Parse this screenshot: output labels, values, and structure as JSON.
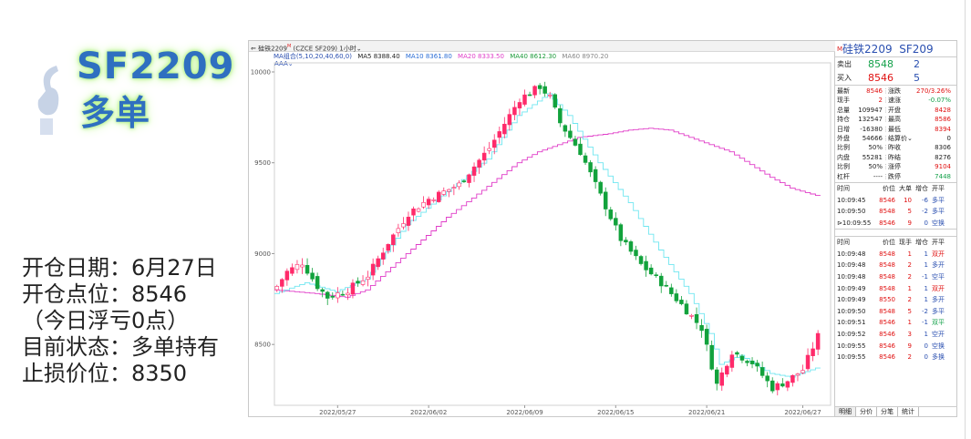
{
  "left": {
    "title": "SF2209",
    "subtitle": "多单",
    "lines": [
      "开仓日期：6月27日",
      "开仓点位：8546",
      "（今日浮亏0点）",
      "目前状态：多单持有",
      "止损价位：8350"
    ]
  },
  "chart_header": {
    "symbol_tab": "硅铁2209",
    "symbol_code": "(CZCE SF209)",
    "period": "1小时",
    "ma_group": "MA组合(5,10,20,40,60,0)",
    "ma5": "MA5 8388.40",
    "ma10": "MA10 8361.80",
    "ma20": "MA20 8333.50",
    "ma40": "MA40 8612.30",
    "ma60": "MA60 8970.20",
    "aaa": "AAA"
  },
  "colors": {
    "up": "#ff2a6a",
    "down": "#12a23c",
    "ma_cyan": "#6fe6f0",
    "ma_magenta": "#e03cc8",
    "ma10": "#2a6dd6",
    "ma20": "#e03cc8",
    "ma40": "#1c9b3a",
    "ma60": "#888888"
  },
  "chart_data": {
    "type": "candlestick",
    "title": "",
    "ylim": [
      8165,
      10050
    ],
    "y_ticks": [
      "10000",
      "9500",
      "9000",
      "8500"
    ],
    "y_tick_values": [
      10000,
      9500,
      9000,
      8500
    ],
    "x_tick_labels": [
      "2022/05/27",
      "2022/06/02",
      "2022/06/09",
      "2022/06/15",
      "2022/06/21",
      "2022/06/27"
    ],
    "x_tick_index": [
      12,
      30,
      49,
      67,
      85,
      104
    ],
    "x_count": 110,
    "anchors_close": [
      [
        0,
        8820
      ],
      [
        2,
        8900
      ],
      [
        5,
        8950
      ],
      [
        8,
        8820
      ],
      [
        10,
        8760
      ],
      [
        14,
        8800
      ],
      [
        18,
        8880
      ],
      [
        22,
        9060
      ],
      [
        26,
        9220
      ],
      [
        30,
        9300
      ],
      [
        36,
        9380
      ],
      [
        42,
        9580
      ],
      [
        48,
        9850
      ],
      [
        52,
        9920
      ],
      [
        54,
        9860
      ],
      [
        56,
        9720
      ],
      [
        60,
        9560
      ],
      [
        64,
        9320
      ],
      [
        68,
        9080
      ],
      [
        72,
        8940
      ],
      [
        76,
        8840
      ],
      [
        80,
        8720
      ],
      [
        84,
        8590
      ],
      [
        87,
        8280
      ],
      [
        90,
        8460
      ],
      [
        94,
        8400
      ],
      [
        98,
        8260
      ],
      [
        101,
        8300
      ],
      [
        104,
        8360
      ],
      [
        107,
        8546
      ]
    ],
    "ma_cyan_anchors": [
      [
        0,
        8780
      ],
      [
        6,
        8840
      ],
      [
        12,
        8790
      ],
      [
        18,
        8860
      ],
      [
        26,
        9160
      ],
      [
        34,
        9340
      ],
      [
        42,
        9520
      ],
      [
        48,
        9760
      ],
      [
        54,
        9880
      ],
      [
        58,
        9760
      ],
      [
        64,
        9500
      ],
      [
        70,
        9280
      ],
      [
        76,
        9020
      ],
      [
        82,
        8780
      ],
      [
        86,
        8560
      ],
      [
        88,
        8390
      ],
      [
        92,
        8440
      ],
      [
        98,
        8340
      ],
      [
        102,
        8320
      ],
      [
        107,
        8370
      ]
    ],
    "ma_magenta_anchors": [
      [
        0,
        8800
      ],
      [
        8,
        8780
      ],
      [
        14,
        8760
      ],
      [
        18,
        8800
      ],
      [
        26,
        9000
      ],
      [
        34,
        9200
      ],
      [
        42,
        9370
      ],
      [
        48,
        9500
      ],
      [
        52,
        9560
      ],
      [
        60,
        9640
      ],
      [
        66,
        9660
      ],
      [
        70,
        9680
      ],
      [
        74,
        9690
      ],
      [
        78,
        9680
      ],
      [
        82,
        9640
      ],
      [
        86,
        9600
      ],
      [
        90,
        9560
      ],
      [
        94,
        9490
      ],
      [
        98,
        9420
      ],
      [
        102,
        9360
      ],
      [
        107,
        9320
      ]
    ]
  },
  "quote": {
    "title_mark": "M",
    "title": "硅铁2209",
    "code": "SF209",
    "sell_label": "卖出",
    "sell_price": "8548",
    "sell_vol": "2",
    "buy_label": "买入",
    "buy_price": "8546",
    "buy_vol": "5",
    "stats": [
      {
        "a": "最新",
        "b": "8546",
        "bc": "red",
        "c": "涨跌",
        "d": "270/3.26%",
        "dc": "red"
      },
      {
        "a": "现手",
        "b": "2",
        "bc": "red",
        "c": "速涨",
        "d": "-0.07%",
        "dc": "green"
      },
      {
        "a": "总量",
        "b": "109947",
        "bc": "",
        "c": "开盘",
        "d": "8428",
        "dc": "red"
      },
      {
        "a": "持仓",
        "b": "132547",
        "bc": "",
        "c": "最高",
        "d": "8586",
        "dc": "red"
      },
      {
        "a": "日增",
        "b": "-16380",
        "bc": "",
        "c": "最低",
        "d": "8394",
        "dc": "red"
      },
      {
        "a": "外盘",
        "b": "54666",
        "bc": "",
        "c": "结算价⌄",
        "d": "0",
        "dc": ""
      },
      {
        "a": "比例",
        "b": "50%",
        "bc": "",
        "c": "昨收",
        "d": "8306",
        "dc": ""
      },
      {
        "a": "内盘",
        "b": "55281",
        "bc": "",
        "c": "昨结",
        "d": "8276",
        "dc": ""
      },
      {
        "a": "比例",
        "b": "50%",
        "bc": "",
        "c": "涨停",
        "d": "9104",
        "dc": "red"
      },
      {
        "a": "杠杆",
        "b": "----",
        "bc": "",
        "c": "跌停",
        "d": "7448",
        "dc": "green"
      }
    ],
    "big_head": [
      "时间",
      "价位",
      "大单",
      "增仓",
      "开平"
    ],
    "big_rows": [
      {
        "time": "10:09:45",
        "price": "8546",
        "vol": "10",
        "chg": "-6",
        "type": "多平",
        "tc": "blue"
      },
      {
        "time": "10:09:50",
        "price": "8548",
        "vol": "5",
        "chg": "-2",
        "type": "多平",
        "tc": "blue"
      },
      {
        "time": "⊳10:09:55",
        "price": "8546",
        "vol": "9",
        "chg": "0",
        "type": "空换",
        "tc": "blue"
      }
    ],
    "tick_head": [
      "时间",
      "价位",
      "现手",
      "增仓",
      "开平"
    ],
    "tick_rows": [
      {
        "time": "10:09:48",
        "price": "8548",
        "vol": "1",
        "chg": "1",
        "type": "双开",
        "tc": "red"
      },
      {
        "time": "10:09:48",
        "price": "8548",
        "vol": "2",
        "chg": "1",
        "type": "多开",
        "tc": "blue"
      },
      {
        "time": "10:09:48",
        "price": "8548",
        "vol": "2",
        "chg": "-1",
        "type": "空平",
        "tc": "blue"
      },
      {
        "time": "10:09:49",
        "price": "8548",
        "vol": "1",
        "chg": "1",
        "type": "双开",
        "tc": "red"
      },
      {
        "time": "10:09:49",
        "price": "8550",
        "vol": "2",
        "chg": "1",
        "type": "多开",
        "tc": "blue"
      },
      {
        "time": "10:09:50",
        "price": "8548",
        "vol": "5",
        "chg": "-2",
        "type": "多平",
        "tc": "blue"
      },
      {
        "time": "10:09:51",
        "price": "8546",
        "vol": "1",
        "chg": "-1",
        "type": "双平",
        "tc": "green"
      },
      {
        "time": "10:09:52",
        "price": "8546",
        "vol": "3",
        "chg": "1",
        "type": "空开",
        "tc": "blue"
      },
      {
        "time": "10:09:55",
        "price": "8546",
        "vol": "9",
        "chg": "0",
        "type": "空换",
        "tc": "blue"
      },
      {
        "time": "10:09:55",
        "price": "8546",
        "vol": "2",
        "chg": "0",
        "type": "多换",
        "tc": "blue"
      }
    ],
    "tabs": [
      "明细",
      "分价",
      "分笔",
      "统计"
    ]
  }
}
